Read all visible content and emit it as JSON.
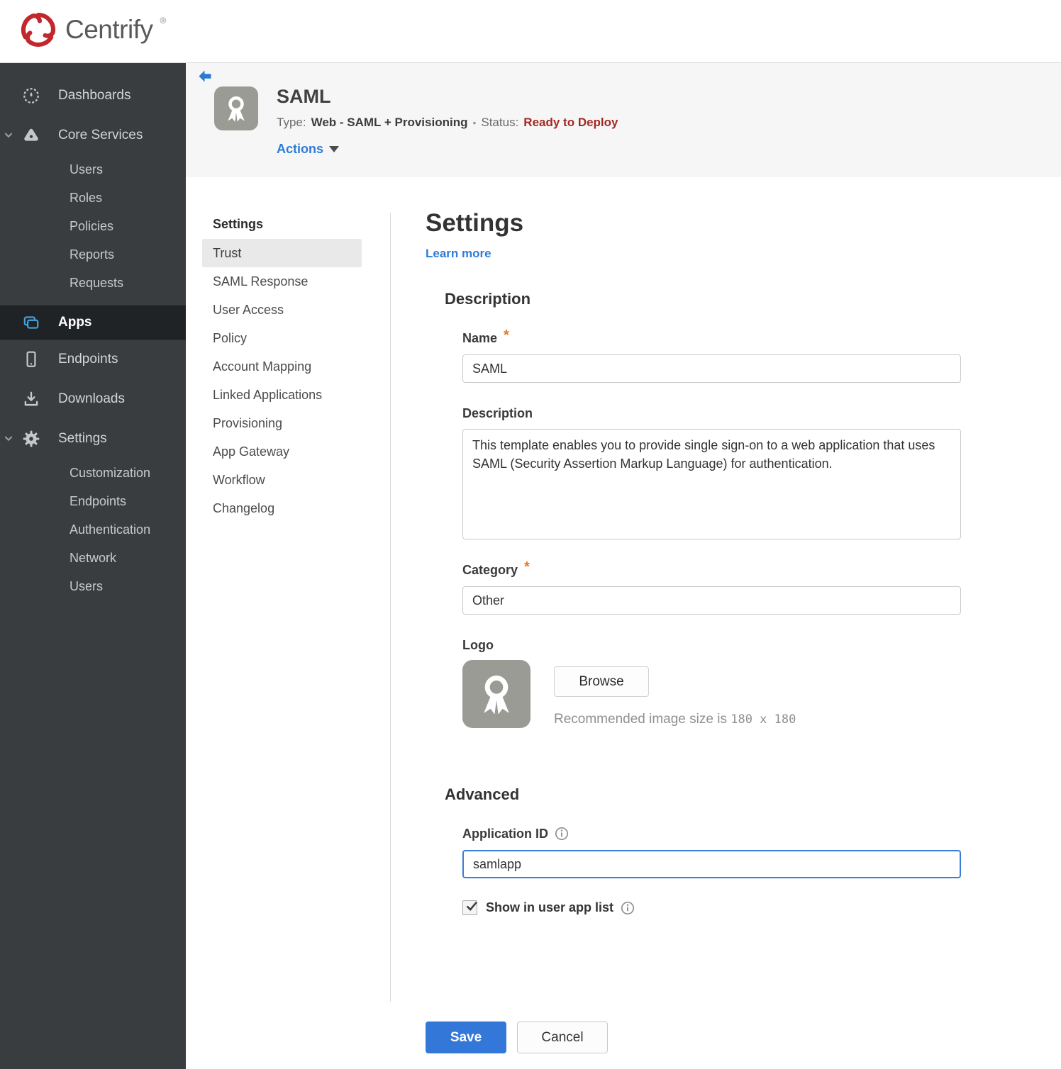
{
  "topbar": {
    "brand": "Centrify",
    "trademark": "®"
  },
  "sidebar": {
    "items": [
      {
        "label": "Dashboards"
      },
      {
        "label": "Core Services",
        "expanded": true,
        "children": [
          "Users",
          "Roles",
          "Policies",
          "Reports",
          "Requests"
        ]
      },
      {
        "label": "Apps",
        "active": true
      },
      {
        "label": "Endpoints"
      },
      {
        "label": "Downloads"
      },
      {
        "label": "Settings",
        "expanded": true,
        "children": [
          "Customization",
          "Endpoints",
          "Authentication",
          "Network",
          "Users"
        ]
      }
    ]
  },
  "app_header": {
    "title": "SAML",
    "type_label": "Type:",
    "type_value": "Web - SAML + Provisioning",
    "separator": "•",
    "status_label": "Status:",
    "status_value": "Ready to Deploy",
    "actions_label": "Actions"
  },
  "subnav": {
    "header": "Settings",
    "active_item": "Trust",
    "items": [
      "Trust",
      "SAML Response",
      "User Access",
      "Policy",
      "Account Mapping",
      "Linked Applications",
      "Provisioning",
      "App Gateway",
      "Workflow",
      "Changelog"
    ]
  },
  "main": {
    "title": "Settings",
    "learn_more": "Learn more",
    "description_section": {
      "heading": "Description",
      "name_label": "Name",
      "name_value": "SAML",
      "description_label": "Description",
      "description_value": "This template enables you to provide single sign-on to a web application that uses SAML (Security Assertion Markup Language) for authentication.",
      "category_label": "Category",
      "category_value": "Other",
      "logo_label": "Logo",
      "browse_label": "Browse",
      "recommended_prefix": "Recommended image size is ",
      "recommended_size": "180 x 180"
    },
    "advanced_section": {
      "heading": "Advanced",
      "application_id_label": "Application ID",
      "application_id_value": "samlapp",
      "show_in_app_list_label": "Show in user app list",
      "checkbox_checked": true
    },
    "save_label": "Save",
    "cancel_label": "Cancel"
  },
  "colors": {
    "accent_blue": "#2e7cd6",
    "save_blue": "#3377d9",
    "status_red": "#a32823",
    "sidebar_bg": "#3a3d40",
    "sidebar_active_bg": "#202326",
    "apps_icon_blue": "#41a4e0",
    "brand_red": "#c1272d",
    "required_orange": "#e87722",
    "logo_gray": "#9b9b95"
  }
}
